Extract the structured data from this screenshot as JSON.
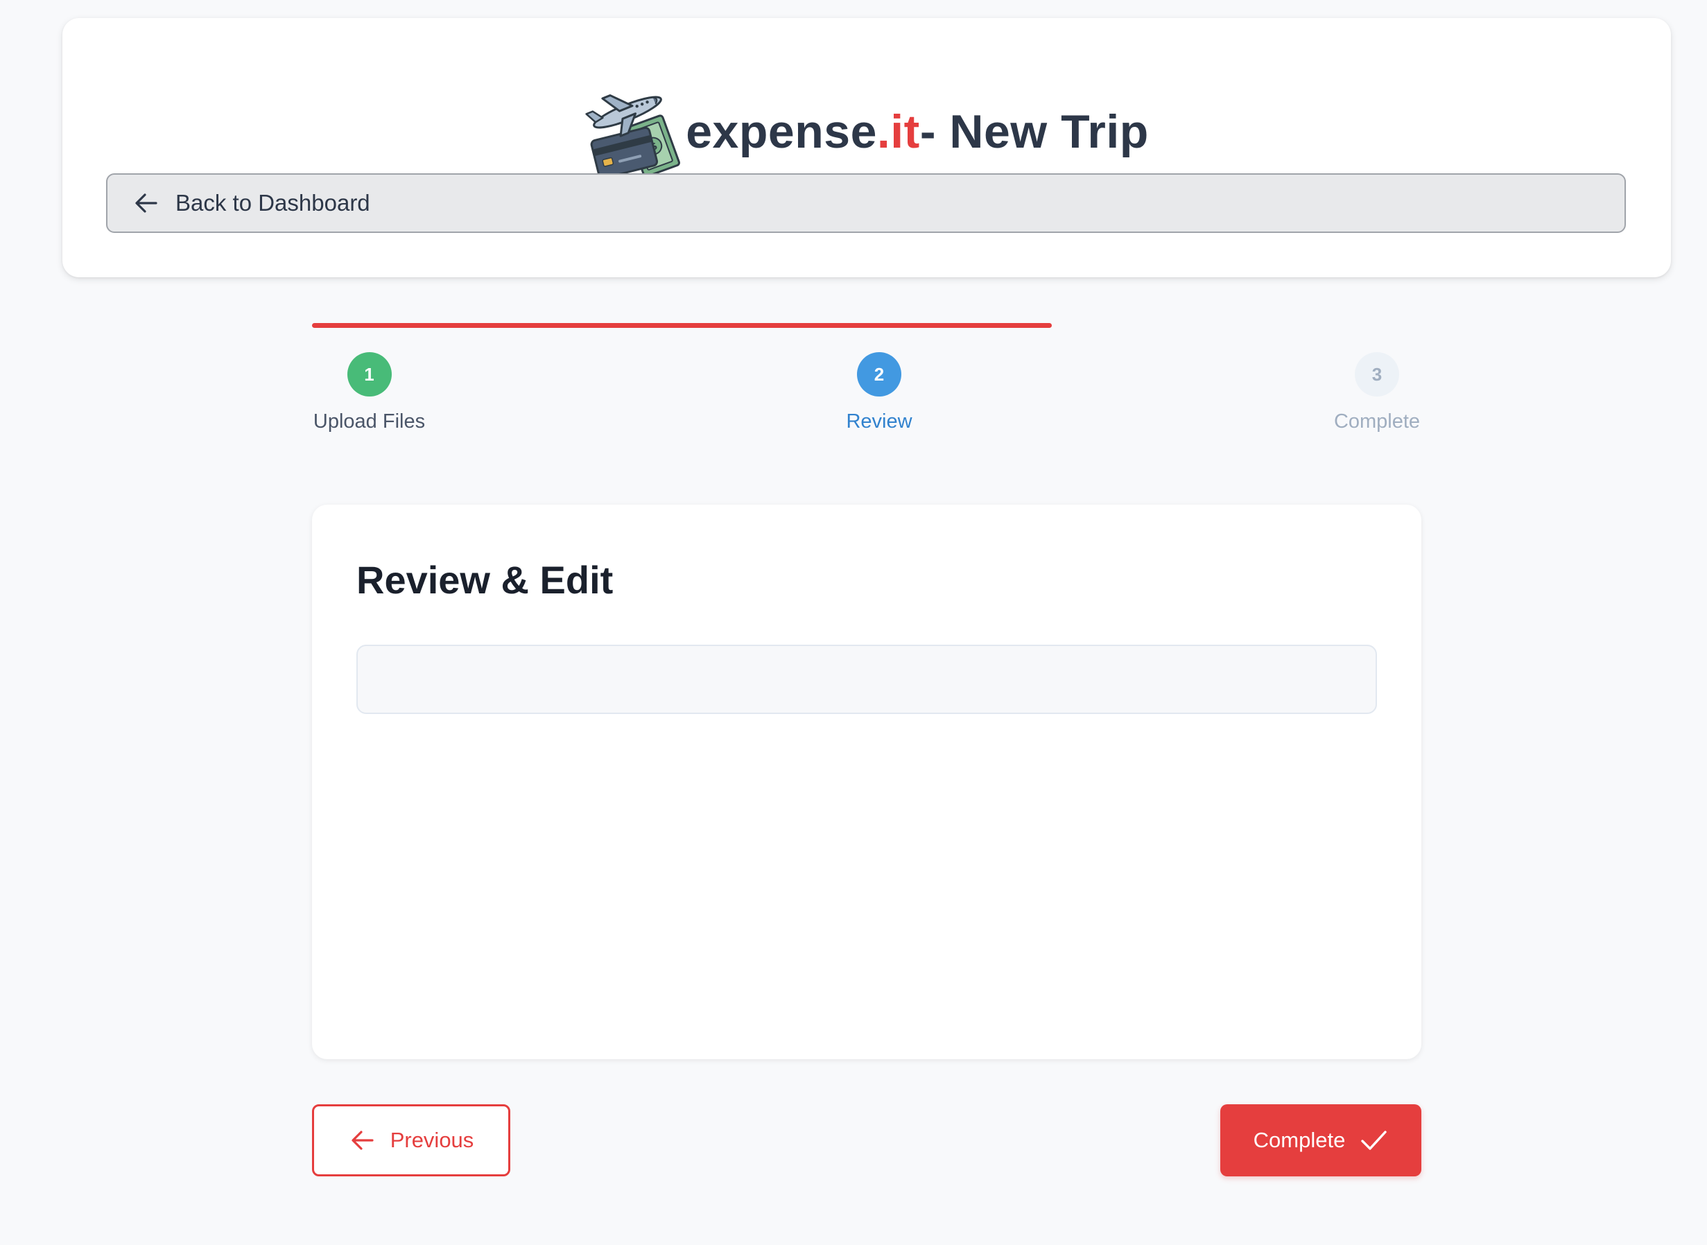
{
  "header": {
    "brand_name": "expense",
    "brand_accent": ".it",
    "title_suffix": "- New Trip",
    "logo_icon": "plane-card-money-icon",
    "back_button_label": "Back to Dashboard",
    "back_icon": "arrow-left-icon"
  },
  "stepper": {
    "progress_fraction": 0.667,
    "steps": [
      {
        "number": "1",
        "label": "Upload Files",
        "status": "completed"
      },
      {
        "number": "2",
        "label": "Review",
        "status": "active"
      },
      {
        "number": "3",
        "label": "Complete",
        "status": "pending"
      }
    ]
  },
  "review": {
    "title": "Review & Edit",
    "content": ""
  },
  "footer": {
    "previous_label": "Previous",
    "previous_icon": "arrow-left-icon",
    "complete_label": "Complete",
    "complete_icon": "checkmark-icon"
  },
  "colors": {
    "accent": "#e53e3e",
    "success": "#48bb78",
    "active": "#4299e1",
    "pending": "#a0aec0",
    "text": "#2d3748"
  }
}
